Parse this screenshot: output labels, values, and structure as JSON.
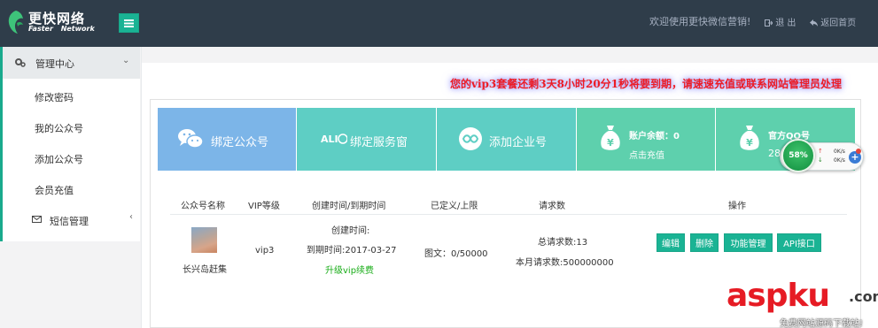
{
  "header": {
    "logo_cn": "更快网络",
    "logo_en": "Faster Network",
    "welcome": "欢迎使用更快微信营销!",
    "logout": "退 出",
    "home": "返回首页"
  },
  "sidebar": {
    "section": "管理中心",
    "items": [
      {
        "label": "修改密码"
      },
      {
        "label": "我的公众号"
      },
      {
        "label": "添加公众号"
      },
      {
        "label": "会员充值"
      }
    ],
    "msg": "短信管理"
  },
  "notice": "您的vip3套餐还剩3天8小时20分1秒将要到期，请速速充值或联系网站管理员处理",
  "tiles": {
    "bind_mp": "绑定公众号",
    "bind_service": "绑定服务窗",
    "add_enterprise": "添加企业号",
    "balance_label": "账户余额：0",
    "recharge": "点击充值",
    "qq_label": "官方QQ号",
    "qq_partial": "285"
  },
  "table": {
    "headers": [
      "公众号名称",
      "VIP等级",
      "创建时间/到期时间",
      "已定义/上限",
      "请求数",
      "操作"
    ],
    "row": {
      "name": "长兴岛赶集",
      "vip": "vip3",
      "created": "创建时间:",
      "expires": "到期时间:2017-03-27",
      "upgrade": "升级vip续费",
      "defined": "图文：0/50000",
      "total_requests": "总请求数:13",
      "month_requests": "本月请求数:500000000",
      "actions": [
        "编辑",
        "删除",
        "功能管理",
        "API接口"
      ]
    }
  },
  "widget": {
    "percent": "58%",
    "up": "0K/s",
    "down": "0K/s"
  },
  "watermark": {
    "brand": "aspku",
    "domain": ".com",
    "sub": "免费网站源码下载站!"
  },
  "colors": {
    "topbar": "#2f3d4a",
    "accent": "#1ab394",
    "tile_blue": "#7cb5e8",
    "tile_teal": "#5ecec4",
    "tile_green": "#5ed0ad",
    "notice": "#ed1c24"
  }
}
